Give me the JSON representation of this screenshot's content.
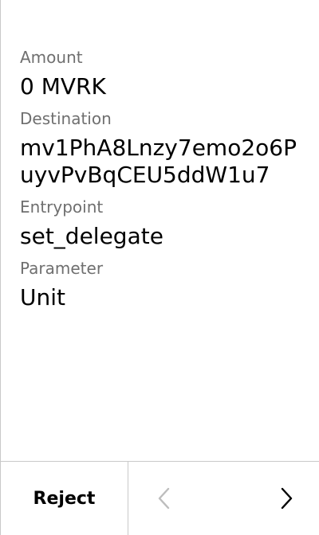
{
  "fields": [
    {
      "label": "Amount",
      "value": "0 MVRK"
    },
    {
      "label": "Destination",
      "value": "mv1PhA8Lnzy7emo2o6PuyvPvBqCEU5ddW1u7"
    },
    {
      "label": "Entrypoint",
      "value": "set_delegate"
    },
    {
      "label": "Parameter",
      "value": "Unit"
    }
  ],
  "footer": {
    "reject_label": "Reject",
    "prev_icon": "chevron-left-icon",
    "next_icon": "chevron-right-icon",
    "prev_color": "#bdbdbd",
    "next_color": "#000000"
  },
  "colors": {
    "background": "#ffffff",
    "label": "#6f6f6f",
    "value": "#000000",
    "divider": "#c9c9c9"
  }
}
